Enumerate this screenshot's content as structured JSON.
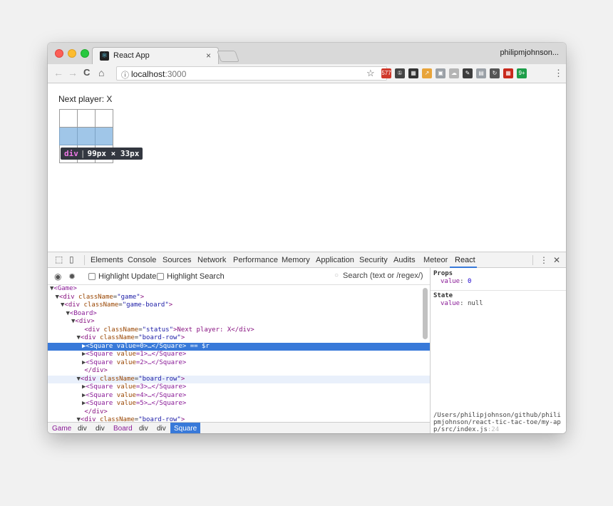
{
  "window": {
    "tab_title": "React App",
    "tab_close": "×",
    "profile": "philipmjohnson...",
    "url_host": "localhost",
    "url_port": ":3000"
  },
  "toolbar": {
    "back": "←",
    "forward": "→",
    "reload": "C",
    "home": "⌂",
    "info": "ⓘ",
    "star": "☆",
    "menu": "⋮",
    "extensions": [
      {
        "name": "ext-577-icon",
        "label": "577",
        "color": "#d0392b"
      },
      {
        "name": "ext-1password-icon",
        "label": "①",
        "color": "#444444"
      },
      {
        "name": "ext-grid-icon",
        "label": "▦",
        "color": "#333333"
      },
      {
        "name": "ext-chart-icon",
        "label": "↗",
        "color": "#e8a43a"
      },
      {
        "name": "ext-photo-icon",
        "label": "▣",
        "color": "#9aa0a6"
      },
      {
        "name": "ext-cloud-icon",
        "label": "☁",
        "color": "#b5b5b5"
      },
      {
        "name": "ext-pen-icon",
        "label": "✎",
        "color": "#3d3d3d"
      },
      {
        "name": "ext-doc-icon",
        "label": "▤",
        "color": "#9aa0a6"
      },
      {
        "name": "ext-refresh-icon",
        "label": "↻",
        "color": "#555555"
      },
      {
        "name": "ext-sheet-icon",
        "label": "▦",
        "color": "#c8291c"
      },
      {
        "name": "ext-badge-icon",
        "label": "9+",
        "color": "#1e9e4a"
      }
    ]
  },
  "page": {
    "status": "Next player: X",
    "tooltip_tag": "div",
    "tooltip_size": "99px × 33px"
  },
  "devtools": {
    "tabs": [
      "Elements",
      "Console",
      "Sources",
      "Network",
      "Performance",
      "Memory",
      "Application",
      "Security",
      "Audits",
      "Meteor",
      "React"
    ],
    "active_tab": "React",
    "menu": "⋮",
    "close": "✕",
    "highlight_updates": "Highlight Updates",
    "highlight_search": "Highlight Search",
    "search_placeholder": "Search (text or /regex/)",
    "tree": [
      {
        "indent": 0,
        "tri": "▼",
        "segments": [
          {
            "t": "<Game>",
            "c": "c-comp"
          }
        ]
      },
      {
        "indent": 1,
        "tri": "▼",
        "segments": [
          {
            "t": "<div ",
            "c": "c-tag"
          },
          {
            "t": "className",
            "c": "c-attr"
          },
          {
            "t": "=",
            "c": "c-plain"
          },
          {
            "t": "\"game\"",
            "c": "c-str"
          },
          {
            "t": ">",
            "c": "c-tag"
          }
        ]
      },
      {
        "indent": 2,
        "tri": "▼",
        "segments": [
          {
            "t": "<div ",
            "c": "c-tag"
          },
          {
            "t": "className",
            "c": "c-attr"
          },
          {
            "t": "=",
            "c": "c-plain"
          },
          {
            "t": "\"game-board\"",
            "c": "c-str"
          },
          {
            "t": ">",
            "c": "c-tag"
          }
        ]
      },
      {
        "indent": 3,
        "tri": "▼",
        "segments": [
          {
            "t": "<Board>",
            "c": "c-comp"
          }
        ]
      },
      {
        "indent": 4,
        "tri": "▼",
        "segments": [
          {
            "t": "<div>",
            "c": "c-tag"
          }
        ]
      },
      {
        "indent": 5,
        "tri": "",
        "segments": [
          {
            "t": "<div ",
            "c": "c-tag"
          },
          {
            "t": "className",
            "c": "c-attr"
          },
          {
            "t": "=",
            "c": "c-plain"
          },
          {
            "t": "\"status\"",
            "c": "c-str"
          },
          {
            "t": ">Next player: X</div>",
            "c": "c-tag"
          }
        ]
      },
      {
        "indent": 5,
        "tri": "▼",
        "segments": [
          {
            "t": "<div ",
            "c": "c-tag"
          },
          {
            "t": "className",
            "c": "c-attr"
          },
          {
            "t": "=",
            "c": "c-plain"
          },
          {
            "t": "\"board-row\"",
            "c": "c-str"
          },
          {
            "t": ">",
            "c": "c-tag"
          }
        ]
      },
      {
        "indent": 6,
        "tri": "▶",
        "selected": true,
        "segments": [
          {
            "t": "<Square ",
            "c": "c-comp"
          },
          {
            "t": "value",
            "c": "c-attr"
          },
          {
            "t": "=0>…</Square> == $r",
            "c": "c-plain"
          }
        ]
      },
      {
        "indent": 6,
        "tri": "▶",
        "segments": [
          {
            "t": "<Square ",
            "c": "c-comp"
          },
          {
            "t": "value",
            "c": "c-attr"
          },
          {
            "t": "=1>…</Square>",
            "c": "c-comp"
          }
        ]
      },
      {
        "indent": 6,
        "tri": "▶",
        "segments": [
          {
            "t": "<Square ",
            "c": "c-comp"
          },
          {
            "t": "value",
            "c": "c-attr"
          },
          {
            "t": "=2>…</Square>",
            "c": "c-comp"
          }
        ]
      },
      {
        "indent": 5,
        "tri": "",
        "segments": [
          {
            "t": "</div>",
            "c": "c-tag"
          }
        ]
      },
      {
        "indent": 5,
        "tri": "▼",
        "hover": true,
        "segments": [
          {
            "t": "<div ",
            "c": "c-tag"
          },
          {
            "t": "className",
            "c": "c-attr"
          },
          {
            "t": "=",
            "c": "c-plain"
          },
          {
            "t": "\"board-row\"",
            "c": "c-str"
          },
          {
            "t": ">",
            "c": "c-tag"
          }
        ]
      },
      {
        "indent": 6,
        "tri": "▶",
        "segments": [
          {
            "t": "<Square ",
            "c": "c-comp"
          },
          {
            "t": "value",
            "c": "c-attr"
          },
          {
            "t": "=3>…</Square>",
            "c": "c-comp"
          }
        ]
      },
      {
        "indent": 6,
        "tri": "▶",
        "segments": [
          {
            "t": "<Square ",
            "c": "c-comp"
          },
          {
            "t": "value",
            "c": "c-attr"
          },
          {
            "t": "=4>…</Square>",
            "c": "c-comp"
          }
        ]
      },
      {
        "indent": 6,
        "tri": "▶",
        "segments": [
          {
            "t": "<Square ",
            "c": "c-comp"
          },
          {
            "t": "value",
            "c": "c-attr"
          },
          {
            "t": "=5>…</Square>",
            "c": "c-comp"
          }
        ]
      },
      {
        "indent": 5,
        "tri": "",
        "segments": [
          {
            "t": "</div>",
            "c": "c-tag"
          }
        ]
      },
      {
        "indent": 5,
        "tri": "▼",
        "segments": [
          {
            "t": "<div ",
            "c": "c-tag"
          },
          {
            "t": "className",
            "c": "c-attr"
          },
          {
            "t": "=",
            "c": "c-plain"
          },
          {
            "t": "\"board-row\"",
            "c": "c-str"
          },
          {
            "t": ">",
            "c": "c-tag"
          }
        ]
      }
    ],
    "breadcrumbs": [
      {
        "label": "Game",
        "kind": "comp"
      },
      {
        "label": "div",
        "kind": "dom"
      },
      {
        "label": "div",
        "kind": "dom"
      },
      {
        "label": "Board",
        "kind": "comp"
      },
      {
        "label": "div",
        "kind": "dom"
      },
      {
        "label": "div",
        "kind": "dom"
      },
      {
        "label": "Square",
        "kind": "active"
      }
    ],
    "props": {
      "props_heading": "Props",
      "prop_key": "value",
      "prop_value": "0",
      "state_heading": "State",
      "state_key": "value",
      "state_value": "null",
      "source_path": "/Users/philipjohnson/github/philipmjohnson/react-tic-tac-toe/my-app/src/index.js",
      "source_line": ":24"
    }
  }
}
